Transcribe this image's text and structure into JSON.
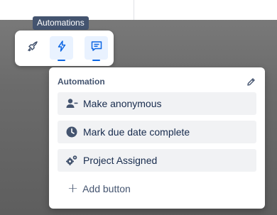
{
  "tooltip": {
    "text": "Automations"
  },
  "toolbar": {
    "buttons": [
      {
        "icon": "rocket-icon",
        "active": false
      },
      {
        "icon": "lightning-icon",
        "active": true
      },
      {
        "icon": "comment-icon",
        "active": true
      }
    ]
  },
  "panel": {
    "title": "Automation",
    "edit_icon": "pencil-icon",
    "actions": [
      {
        "label": "Make anonymous",
        "icon": "user-minus-icon"
      },
      {
        "label": "Mark due date complete",
        "icon": "clock-icon"
      },
      {
        "label": "Project Assigned",
        "icon": "gears-icon"
      }
    ],
    "add_button_label": "Add button"
  },
  "colors": {
    "accent": "#0c66e4",
    "active_bg": "#e9f2ff",
    "tooltip_bg": "#44546f",
    "text": "#172b4d",
    "subtle_text": "#44546f",
    "action_bg": "#f1f2f4"
  }
}
